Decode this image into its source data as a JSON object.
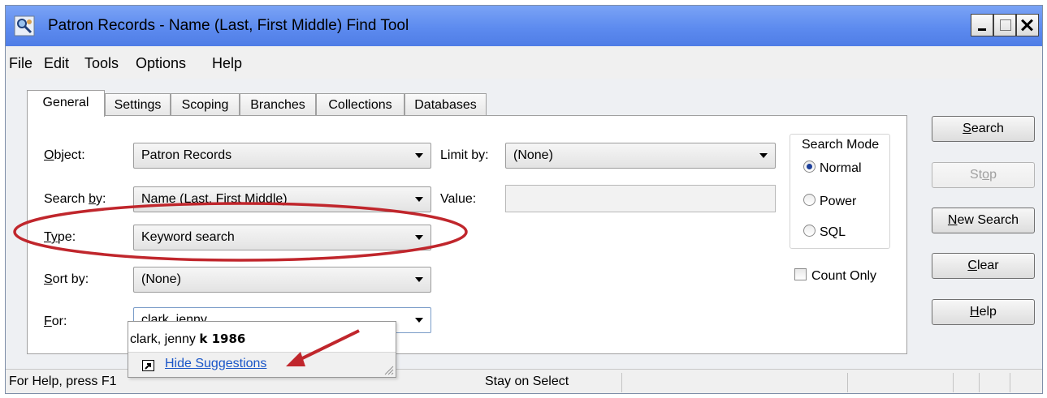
{
  "window": {
    "title": "Patron Records - Name (Last, First Middle) Find Tool",
    "app_icon": "magnifier-person-icon"
  },
  "menu": [
    "File",
    "Edit",
    "Tools",
    "Options",
    "Help"
  ],
  "tabs": [
    "General",
    "Settings",
    "Scoping",
    "Branches",
    "Collections",
    "Databases"
  ],
  "active_tab": "General",
  "form": {
    "object": {
      "label_a": "O",
      "label_b": "bject:",
      "value": "Patron Records"
    },
    "limit_by": {
      "label": "Limit by:",
      "value": "(None)"
    },
    "search_by": {
      "label_a": "Search ",
      "label_b": "b",
      "label_c": "y:",
      "value": "Name (Last, First Middle)"
    },
    "value_field": {
      "label": "Value:",
      "value": ""
    },
    "type": {
      "label_a": "T",
      "label_b": "y",
      "label_c": "pe:",
      "value": "Keyword search"
    },
    "sort_by": {
      "label_a": "S",
      "label_b": "ort by:",
      "value": "(None)"
    },
    "for": {
      "label_a": "F",
      "label_b": "or:",
      "value": "clark, jenny"
    }
  },
  "search_mode": {
    "title": "Search Mode",
    "options": [
      "Normal",
      "Power",
      "SQL"
    ],
    "selected": "Normal"
  },
  "count_only": {
    "label": "Count Only",
    "checked": false
  },
  "buttons": {
    "search": {
      "a": "S",
      "b": "earch"
    },
    "stop": {
      "a": "St",
      "b": "o",
      "c": "p"
    },
    "new_search": {
      "a": "N",
      "b": "ew Search"
    },
    "clear": {
      "a": "C",
      "b": "lear"
    },
    "help": {
      "a": "H",
      "b": "elp"
    }
  },
  "suggestions": {
    "item_prefix": "clark, jenny ",
    "item_bold": "k 1986",
    "hide_label": "Hide Suggestions"
  },
  "status_bar": {
    "help_text": "For Help, press F1",
    "mode_text": "Stay on Select"
  },
  "annotation": {
    "color": "#c0262c"
  }
}
